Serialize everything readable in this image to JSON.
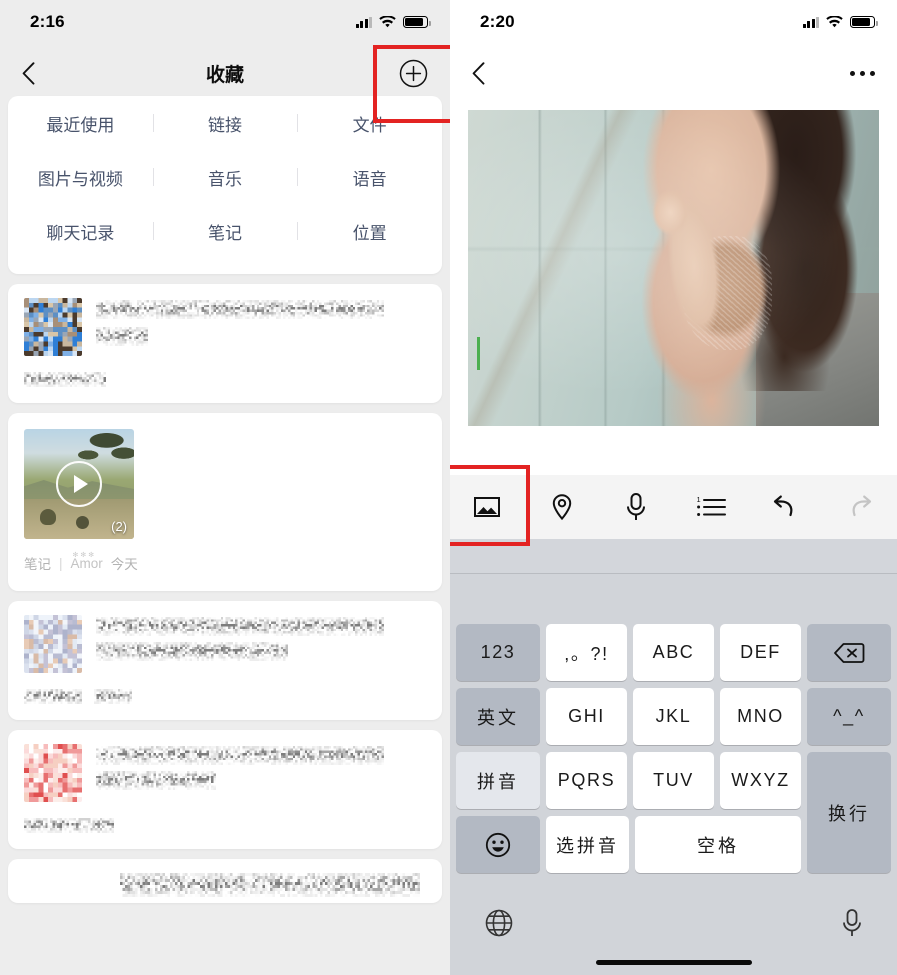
{
  "left": {
    "status": {
      "time": "2:16",
      "signal_icon": "cellular-signal-icon",
      "wifi_icon": "wifi-icon",
      "battery_icon": "battery-icon"
    },
    "nav": {
      "back_icon": "chevron-left-icon",
      "title": "收藏",
      "add_icon": "plus-circle-icon"
    },
    "filters": [
      [
        "最近使用",
        "链接",
        "文件"
      ],
      [
        "图片与视频",
        "音乐",
        "语音"
      ],
      [
        "聊天记录",
        "笔记",
        "位置"
      ]
    ],
    "video_card": {
      "play_icon": "play-circle-icon",
      "count_label": "(2)",
      "type_label": "笔记",
      "separator": "|",
      "author_label": "Amor",
      "date_label": "今天"
    },
    "redacted_note": "blurred-content"
  },
  "right": {
    "status": {
      "time": "2:20",
      "signal_icon": "cellular-signal-icon",
      "wifi_icon": "wifi-icon",
      "battery_icon": "battery-icon"
    },
    "nav": {
      "back_icon": "chevron-left-icon",
      "more_icon": "more-horizontal-icon"
    },
    "photo": {
      "alt_name": "attached-photo"
    },
    "cursor_color": "#4caf50",
    "toolbar": [
      {
        "name": "image-icon",
        "label": ""
      },
      {
        "name": "location-pin-icon",
        "label": ""
      },
      {
        "name": "microphone-icon",
        "label": ""
      },
      {
        "name": "numbered-list-icon",
        "label": ""
      },
      {
        "name": "undo-icon",
        "label": ""
      },
      {
        "name": "redo-icon",
        "label": ""
      }
    ],
    "keyboard": {
      "rows": [
        [
          {
            "label": "123",
            "style": "dark",
            "name": "key-123"
          },
          {
            "label": ",。?!",
            "style": "light",
            "name": "key-punctuation"
          },
          {
            "label": "ABC",
            "style": "light",
            "name": "key-abc"
          },
          {
            "label": "DEF",
            "style": "light",
            "name": "key-def"
          },
          {
            "label": "",
            "style": "dark",
            "name": "key-backspace",
            "icon": "backspace-icon"
          }
        ],
        [
          {
            "label": "英文",
            "style": "dark",
            "name": "key-english"
          },
          {
            "label": "GHI",
            "style": "light",
            "name": "key-ghi"
          },
          {
            "label": "JKL",
            "style": "light",
            "name": "key-jkl"
          },
          {
            "label": "MNO",
            "style": "light",
            "name": "key-mno"
          },
          {
            "label": "^_^",
            "style": "dark",
            "name": "key-kaomoji"
          }
        ],
        [
          {
            "label": "拼音",
            "style": "pinyin",
            "name": "key-pinyin"
          },
          {
            "label": "PQRS",
            "style": "light",
            "name": "key-pqrs"
          },
          {
            "label": "TUV",
            "style": "light",
            "name": "key-tuv"
          },
          {
            "label": "WXYZ",
            "style": "light",
            "name": "key-wxyz"
          },
          {
            "label": "换行",
            "style": "dark",
            "name": "key-return"
          }
        ],
        [
          {
            "label": "",
            "style": "dark",
            "name": "key-emoji",
            "icon": "smiley-icon"
          },
          {
            "label": "选拼音",
            "style": "light",
            "name": "key-select-pinyin"
          },
          {
            "label": "空格",
            "style": "light",
            "name": "key-space"
          }
        ]
      ],
      "globe_icon": "globe-icon",
      "mic_icon": "microphone-icon"
    }
  },
  "annotations": {
    "color": "#e32322",
    "boxes": [
      {
        "name": "highlight-add-button",
        "target": "plus-circle-icon"
      },
      {
        "name": "highlight-image-tool",
        "target": "image-icon"
      }
    ]
  }
}
